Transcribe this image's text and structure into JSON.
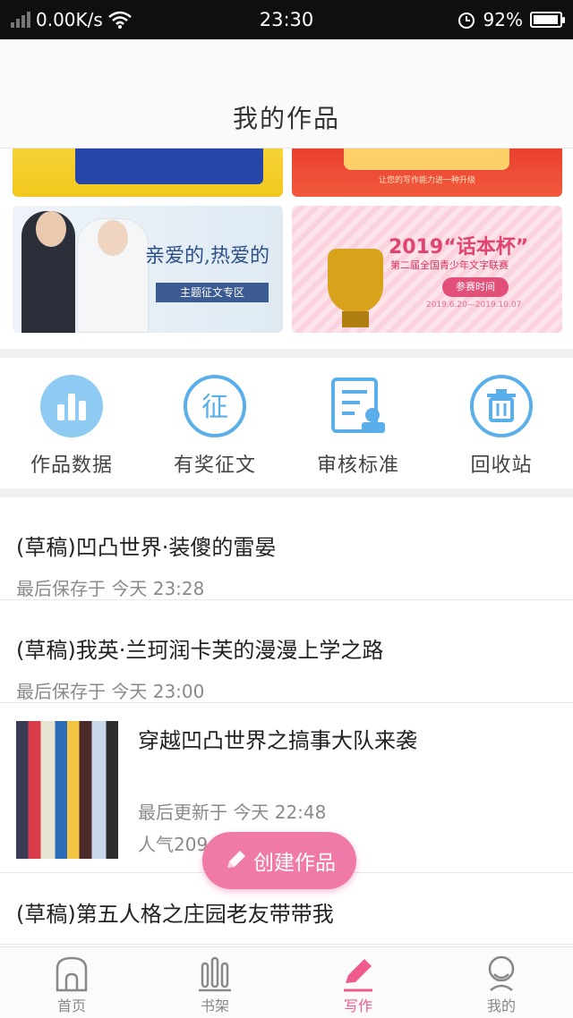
{
  "status_bar": {
    "net_speed": "0.00K/s",
    "time": "23:30",
    "battery": "92%"
  },
  "header": {
    "title": "我的作品"
  },
  "banners": {
    "top_right_caption": "让您的写作能力进一种升级",
    "bottom_left_title": "亲爱的,热爱的",
    "bottom_left_tag": "主题征文专区",
    "bottom_right_title": "2019“话本杯”",
    "bottom_right_subtitle": "第二届全国青少年文字联赛",
    "bottom_right_pill": "参赛时间",
    "bottom_right_dates": "2019.6.20—2019.10.07"
  },
  "actions": [
    {
      "label": "作品数据",
      "icon": "bar-chart-icon"
    },
    {
      "label": "有奖征文",
      "icon": "contest-icon"
    },
    {
      "label": "审核标准",
      "icon": "review-document-icon"
    },
    {
      "label": "回收站",
      "icon": "trash-icon"
    }
  ],
  "works": {
    "draft1": {
      "title": "(草稿)凹凸世界·装傻的雷晏",
      "meta": "最后保存于 今天 23:28"
    },
    "draft2": {
      "title": "(草稿)我英·兰珂润卡芙的漫漫上学之路",
      "meta": "最后保存于 今天 23:00"
    },
    "published": {
      "title": "穿越凹凸世界之搞事大队来袭",
      "updated": "最后更新于 今天 22:48",
      "popularity": "人气209"
    },
    "draft3": {
      "title": "(草稿)第五人格之庄园老友带带我"
    }
  },
  "fab": {
    "label": "创建作品"
  },
  "bottom_nav": [
    {
      "label": "首页",
      "icon": "home-icon"
    },
    {
      "label": "书架",
      "icon": "bookshelf-icon"
    },
    {
      "label": "写作",
      "icon": "pen-icon"
    },
    {
      "label": "我的",
      "icon": "profile-icon"
    }
  ],
  "colors": {
    "accent": "#ee5c8f",
    "icon_blue": "#5aaee9",
    "fab": "#f07aa7"
  }
}
